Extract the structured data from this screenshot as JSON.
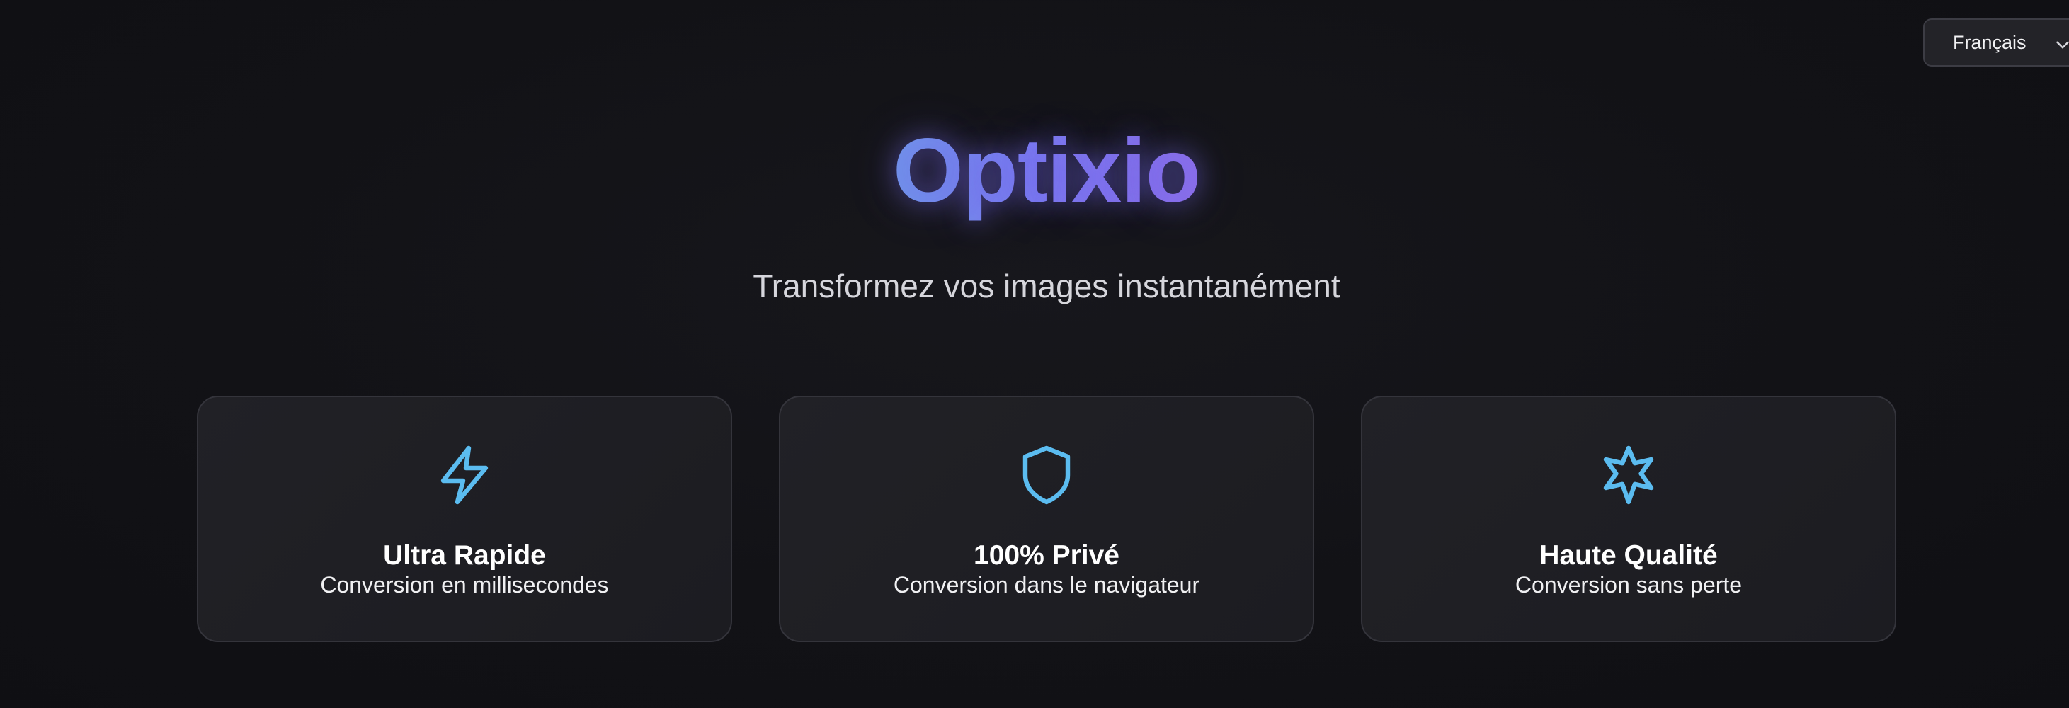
{
  "language_selector": {
    "selected": "Français",
    "icon": "chevron-down-icon"
  },
  "hero": {
    "brand": "Optixio",
    "tagline": "Transformez vos images instantanément"
  },
  "features": [
    {
      "icon": "lightning-bolt-icon",
      "title": "Ultra Rapide",
      "description": "Conversion en millisecondes"
    },
    {
      "icon": "shield-icon",
      "title": "100% Privé",
      "description": "Conversion dans le navigateur"
    },
    {
      "icon": "sparkle-star-icon",
      "title": "Haute Qualité",
      "description": "Conversion sans perte"
    }
  ],
  "colors": {
    "background": "#121216",
    "card_background": "#1f1f24",
    "brand_gradient_start": "#6f9ce8",
    "brand_gradient_end": "#8f6fe8",
    "icon_accent": "#5bbcf0"
  }
}
